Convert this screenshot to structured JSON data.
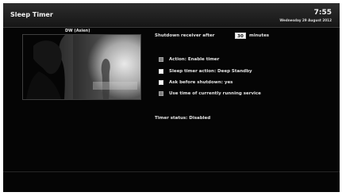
{
  "window": {
    "title": "Sleep Timer",
    "time": "7:55",
    "date": "Wednesday 29 August 2012"
  },
  "preview": {
    "channel": "DW (Asien)"
  },
  "settings": {
    "shutdown_label": "Shutdown receiver after",
    "minutes_value": "30",
    "minutes_unit": "minutes",
    "items": [
      {
        "label": "Action: Enable timer"
      },
      {
        "label": "Sleep timer action: Deep Standby"
      },
      {
        "label": "Ask before shutdown: yes"
      },
      {
        "label": "Use time of currently running service"
      }
    ],
    "status": "Timer status: Disabled"
  }
}
